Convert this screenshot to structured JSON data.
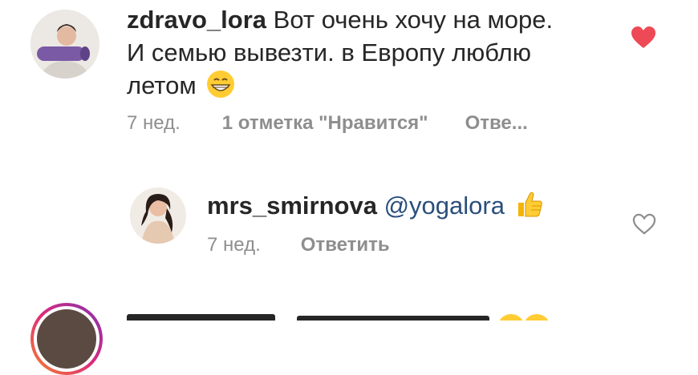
{
  "comments": [
    {
      "username": "zdravo_lora",
      "text_lines": [
        "Вот очень хочу на море.",
        "И семью вывезти.  в Европу люблю",
        "летом"
      ],
      "emoji": "grinning-face",
      "time": "7 нед.",
      "likes": "1 отметка \"Нравится\"",
      "reply": "Отве...",
      "liked": true,
      "heart_color": "#ed4956"
    },
    {
      "username": "mrs_smirnova",
      "mention": "@yogalora",
      "emoji": "thumbs-up",
      "time": "7 нед.",
      "reply": "Ответить",
      "liked": false
    },
    {
      "username_partial": "",
      "text_partial": "",
      "story_ring": true
    }
  ]
}
